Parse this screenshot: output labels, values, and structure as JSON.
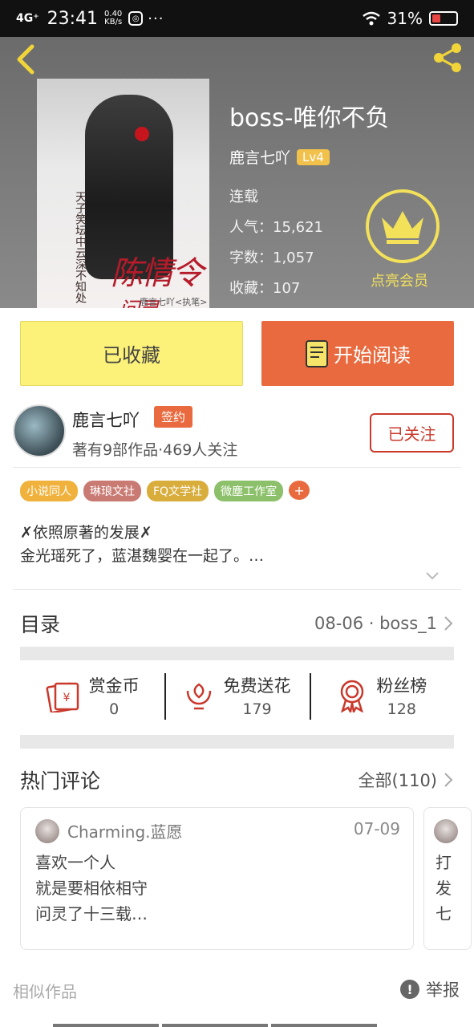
{
  "status_bar": {
    "network": "4G⁺",
    "time": "23:41",
    "speed": "0.40",
    "speed_unit": "KB/s",
    "more": "···",
    "battery": "31%",
    "battery_level": 0.31
  },
  "book": {
    "title": "boss-唯你不负",
    "author": "鹿言七吖",
    "level": "Lv4",
    "status": "连载",
    "popularity": "人气：15,621",
    "word_count": "字数：1,057",
    "favorites": "收藏：107",
    "cover_title": "陈情令",
    "cover_sub": "问灵",
    "cover_author": "鹿言七吖<执笔>",
    "cover_vertical": "天子笑坛中云深不知处"
  },
  "vip": {
    "label": "点亮会员"
  },
  "actions": {
    "favorited": "已收藏",
    "read": "开始阅读"
  },
  "author_card": {
    "name": "鹿言七吖",
    "badge": "签约",
    "stats": "著有9部作品·469人关注",
    "follow": "已关注"
  },
  "tags": [
    {
      "label": "小说同人",
      "color": "#f0b23c"
    },
    {
      "label": "琳琅文社",
      "color": "#c97a73"
    },
    {
      "label": "FQ文学社",
      "color": "#d9ad3c"
    },
    {
      "label": "微塵工作室",
      "color": "#8cc06a"
    }
  ],
  "tag_more": "+",
  "intro": {
    "line1": "✗依照原著的发展✗",
    "line2": "金光瑶死了，蓝湛魏婴在一起了。…"
  },
  "toc": {
    "label": "目录",
    "latest": "08-06 · boss_1"
  },
  "stats": [
    {
      "label": "赏金币",
      "value": "0",
      "icon": "red-envelope-icon"
    },
    {
      "label": "免费送花",
      "value": "179",
      "icon": "flower-icon"
    },
    {
      "label": "粉丝榜",
      "value": "128",
      "icon": "medal-icon"
    }
  ],
  "hot_comments": {
    "label": "热门评论",
    "all": "全部(110)",
    "items": [
      {
        "user": "Charming.蓝愿",
        "date": "07-09",
        "line1": "喜欢一个人",
        "line2": "就是要相依相守",
        "line3": "问灵了十三载…"
      },
      {
        "line1": "打",
        "line2": "发",
        "line3": "七"
      }
    ]
  },
  "footer": {
    "similar": "相似作品",
    "report": "举报",
    "report_icon": "!"
  }
}
